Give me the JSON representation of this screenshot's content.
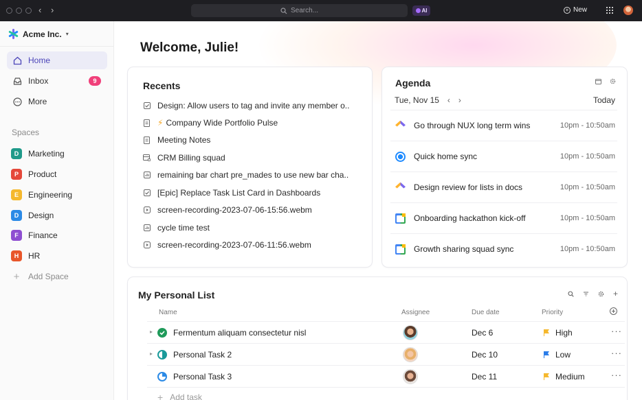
{
  "topbar": {
    "search_placeholder": "Search...",
    "ai_label": "AI",
    "new_label": "New"
  },
  "sidebar": {
    "workspace": "Acme Inc.",
    "nav": [
      {
        "label": "Home",
        "icon": "home-icon",
        "active": true
      },
      {
        "label": "Inbox",
        "icon": "inbox-icon",
        "badge": "9"
      },
      {
        "label": "More",
        "icon": "more-icon"
      }
    ],
    "spaces_heading": "Spaces",
    "spaces": [
      {
        "letter": "D",
        "label": "Marketing",
        "color": "#1f9a8a"
      },
      {
        "letter": "P",
        "label": "Product",
        "color": "#e5483a"
      },
      {
        "letter": "E",
        "label": "Engineering",
        "color": "#f5b82e"
      },
      {
        "letter": "D",
        "label": "Design",
        "color": "#2b8ae6"
      },
      {
        "letter": "F",
        "label": "Finance",
        "color": "#8e4fd1"
      },
      {
        "letter": "H",
        "label": "HR",
        "color": "#e8562a"
      }
    ],
    "add_space": "Add Space"
  },
  "main": {
    "welcome": "Welcome, Julie!",
    "recents": {
      "title": "Recents",
      "items": [
        {
          "icon": "checkbox-icon",
          "label": "Design: Allow users to tag and invite any member o..."
        },
        {
          "icon": "doc-icon",
          "prefix": "⚡",
          "label": "Company Wide Portfolio Pulse"
        },
        {
          "icon": "doc-icon",
          "label": "Meeting Notes"
        },
        {
          "icon": "list-icon",
          "label": "CRM Billing squad"
        },
        {
          "icon": "chart-icon",
          "label": "remaining bar chart pre_mades to use new bar cha..."
        },
        {
          "icon": "checkbox-icon",
          "label": "[Epic] Replace Task List Card in Dashboards"
        },
        {
          "icon": "video-icon",
          "label": "screen-recording-2023-07-06-15:56.webm"
        },
        {
          "icon": "chart-icon",
          "label": "cycle time test"
        },
        {
          "icon": "video-icon",
          "label": "screen-recording-2023-07-06-11:56.webm"
        }
      ]
    },
    "agenda": {
      "title": "Agenda",
      "date": "Tue, Nov 15",
      "today": "Today",
      "events": [
        {
          "icon": "clickup-icon",
          "title": "Go through NUX long term wins",
          "time": "10pm - 10:50am"
        },
        {
          "icon": "ring-icon",
          "title": "Quick home sync",
          "time": "10pm - 10:50am"
        },
        {
          "icon": "clickup-icon",
          "title": "Design review for lists in docs",
          "time": "10pm - 10:50am"
        },
        {
          "icon": "google-calendar-icon",
          "title": "Onboarding hackathon kick-off",
          "time": "10pm - 10:50am"
        },
        {
          "icon": "google-calendar-icon",
          "title": "Growth sharing squad sync",
          "time": "10pm - 10:50am"
        }
      ]
    },
    "personal_list": {
      "title": "My Personal List",
      "columns": {
        "name": "Name",
        "assignee": "Assignee",
        "due": "Due date",
        "priority": "Priority"
      },
      "tasks": [
        {
          "name": "Fermentum aliquam consectetur nisl",
          "due": "Dec 6",
          "priority": "High",
          "flag_color": "#f5b82e",
          "status": "complete",
          "status_color": "#1f9a5a",
          "expand": true
        },
        {
          "name": "Personal Task 2",
          "due": "Dec 10",
          "priority": "Low",
          "flag_color": "#2b7de9",
          "status": "in-progress",
          "status_color": "#1a9a9a",
          "expand": true
        },
        {
          "name": "Personal Task 3",
          "due": "Dec 11",
          "priority": "Medium",
          "flag_color": "#f5b82e",
          "status": "in-progress",
          "status_color": "#2b8ae6",
          "expand": false
        }
      ],
      "add_task": "Add task"
    }
  }
}
